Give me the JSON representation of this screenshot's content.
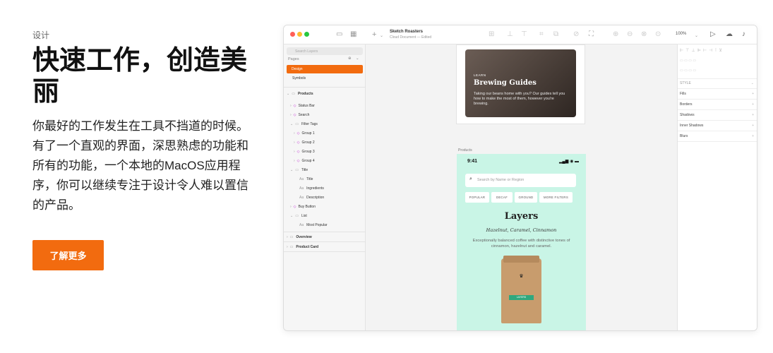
{
  "hero": {
    "eyebrow": "设计",
    "title": "快速工作，创造美丽",
    "description": "你最好的工作发生在工具不挡道的时候。有了一个直观的界面，深思熟虑的功能和所有的功能，一个本地的MacOS应用程序，你可以继续专注于设计令人难以置信的产品。",
    "cta_label": "了解更多"
  },
  "colors": {
    "accent": "#f26b0f",
    "canvas_card": "#c9f5e6",
    "symbol": "#c026d3"
  },
  "app": {
    "doc_title": "Sketch Roasters",
    "doc_subtitle": "Cloud Document — Edited",
    "zoom": "100%",
    "search_placeholder": "Search Layers",
    "pages_label": "Pages",
    "pages": [
      "Design",
      "Symbols"
    ],
    "layers": {
      "products": "Products",
      "status_bar": "Status Bar",
      "search": "Search",
      "filter_tags": "Filter Tags",
      "group1": "Group 1",
      "group2": "Group 2",
      "group3": "Group 3",
      "group4": "Group 4",
      "title": "Title",
      "title_text": "Title",
      "ingredients": "Ingredients",
      "description": "Description",
      "buy_button": "Buy Button",
      "list": "List",
      "most_popular": "Most Popular",
      "overview": "Overview",
      "product_card": "Product Card"
    },
    "inspector": {
      "style": "STYLE",
      "fills": "Fills",
      "borders": "Borders",
      "shadows": "Shadows",
      "inner_shadows": "Inner Shadows",
      "blurs": "Blurs"
    },
    "card": {
      "tag": "LEARN",
      "title": "Brewing Guides",
      "text": "Taking our beans home with you? Our guides tell you how to make the most of them, however you're brewing."
    },
    "artboard_label": "Products",
    "phone": {
      "time": "9:41",
      "search_placeholder": "Search by Name or Region",
      "chips": [
        "POPULAR",
        "DECAF",
        "GROUND",
        "MORE FILTERS"
      ],
      "title": "Layers",
      "subtitle": "Hazelnut, Caramel, Cinnamon",
      "desc": "Exceptionally balanced coffee with distinctive tones of cinnamon, hazelnut and caramel.",
      "bag_label": "LAYERS"
    }
  }
}
